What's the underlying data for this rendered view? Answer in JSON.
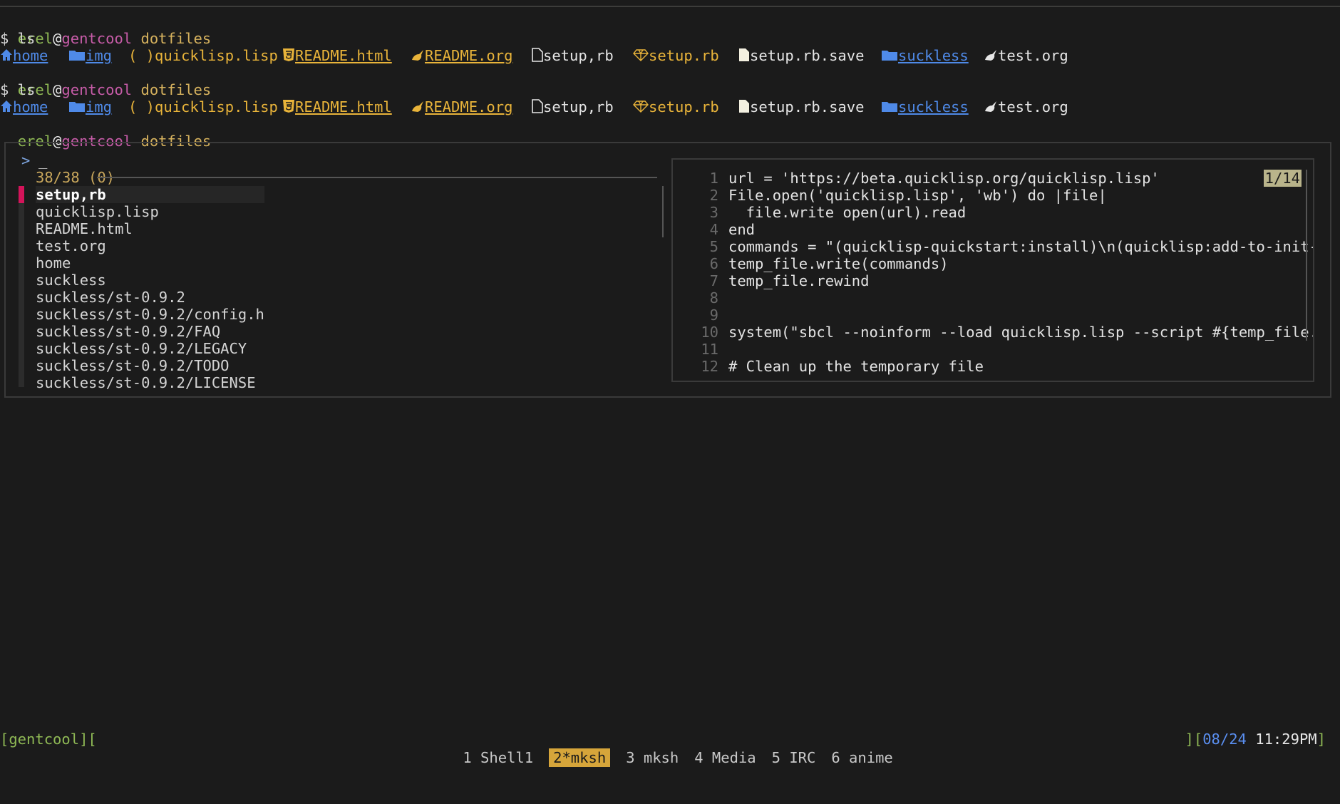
{
  "terminal": {
    "prompt": {
      "user": "erel",
      "at": "@",
      "host": "gentcool",
      "cwd": "dotfiles"
    },
    "command": "$ ls",
    "ls_items": [
      {
        "name": "home",
        "icon": "home-icon",
        "style": "blue"
      },
      {
        "name": "img",
        "icon": "folder-icon",
        "style": "blue"
      },
      {
        "name": "quicklisp.lisp",
        "icon": "lisp-parens-icon",
        "glyph": "( )",
        "style": "gold"
      },
      {
        "name": "README.html",
        "icon": "html5-icon",
        "style": "gold-underline"
      },
      {
        "name": "README.org",
        "icon": "org-unicorn-icon",
        "style": "gold-underline"
      },
      {
        "name": "setup,rb",
        "icon": "file-icon",
        "style": "white"
      },
      {
        "name": "setup.rb",
        "icon": "ruby-gem-icon",
        "style": "gold"
      },
      {
        "name": "setup.rb.save",
        "icon": "file-icon",
        "style": "white"
      },
      {
        "name": "suckless",
        "icon": "folder-icon",
        "style": "blue"
      },
      {
        "name": "test.org",
        "icon": "org-unicorn-icon",
        "style": "white"
      }
    ]
  },
  "fzf": {
    "prompt_symbol": ">",
    "cursor": "_",
    "count": "38/38 (0)",
    "items": [
      "setup,rb",
      "quicklisp.lisp",
      "README.html",
      "test.org",
      "home",
      "suckless",
      "suckless/st-0.9.2",
      "suckless/st-0.9.2/config.h",
      "suckless/st-0.9.2/FAQ",
      "suckless/st-0.9.2/LEGACY",
      "suckless/st-0.9.2/TODO",
      "suckless/st-0.9.2/LICENSE"
    ],
    "selected_index": 0
  },
  "preview": {
    "position": "1/14",
    "lines": [
      {
        "n": "1",
        "text": "url = 'https://beta.quicklisp.org/quicklisp.lisp'"
      },
      {
        "n": "2",
        "text": "File.open('quicklisp.lisp', 'wb') do |file|"
      },
      {
        "n": "3",
        "text": "  file.write open(url).read"
      },
      {
        "n": "4",
        "text": "end"
      },
      {
        "n": "5",
        "text": "commands = \"(quicklisp-quickstart:install)\\n(quicklisp:add-to-init-"
      },
      {
        "n": "6",
        "text": "temp_file.write(commands)"
      },
      {
        "n": "7",
        "text": "temp_file.rewind"
      },
      {
        "n": "8",
        "text": ""
      },
      {
        "n": "9",
        "text": ""
      },
      {
        "n": "10",
        "text": "system(\"sbcl --noinform --load quicklisp.lisp --script #{temp_file."
      },
      {
        "n": "11",
        "text": ""
      },
      {
        "n": "12",
        "text": "# Clean up the temporary file"
      }
    ]
  },
  "statusbar": {
    "left": "[gentcool][",
    "tabs": [
      {
        "label": "1 Shell1",
        "active": false
      },
      {
        "label": "2*mksh",
        "active": true
      },
      {
        "label": "3 mksh",
        "active": false
      },
      {
        "label": "4 Media",
        "active": false
      },
      {
        "label": "5 IRC",
        "active": false
      },
      {
        "label": "6 anime",
        "active": false
      }
    ],
    "right_bracket": "][",
    "date": "08/24",
    "time": "11:29PM",
    "end_bracket": "]"
  },
  "colors": {
    "background": "#1b1b1b",
    "green": "#8fb955",
    "purple": "#c75ca8",
    "blue": "#4f8ae8",
    "gold": "#e9b43a",
    "marker": "#d4145a",
    "active_tab": "#d6a53a"
  }
}
